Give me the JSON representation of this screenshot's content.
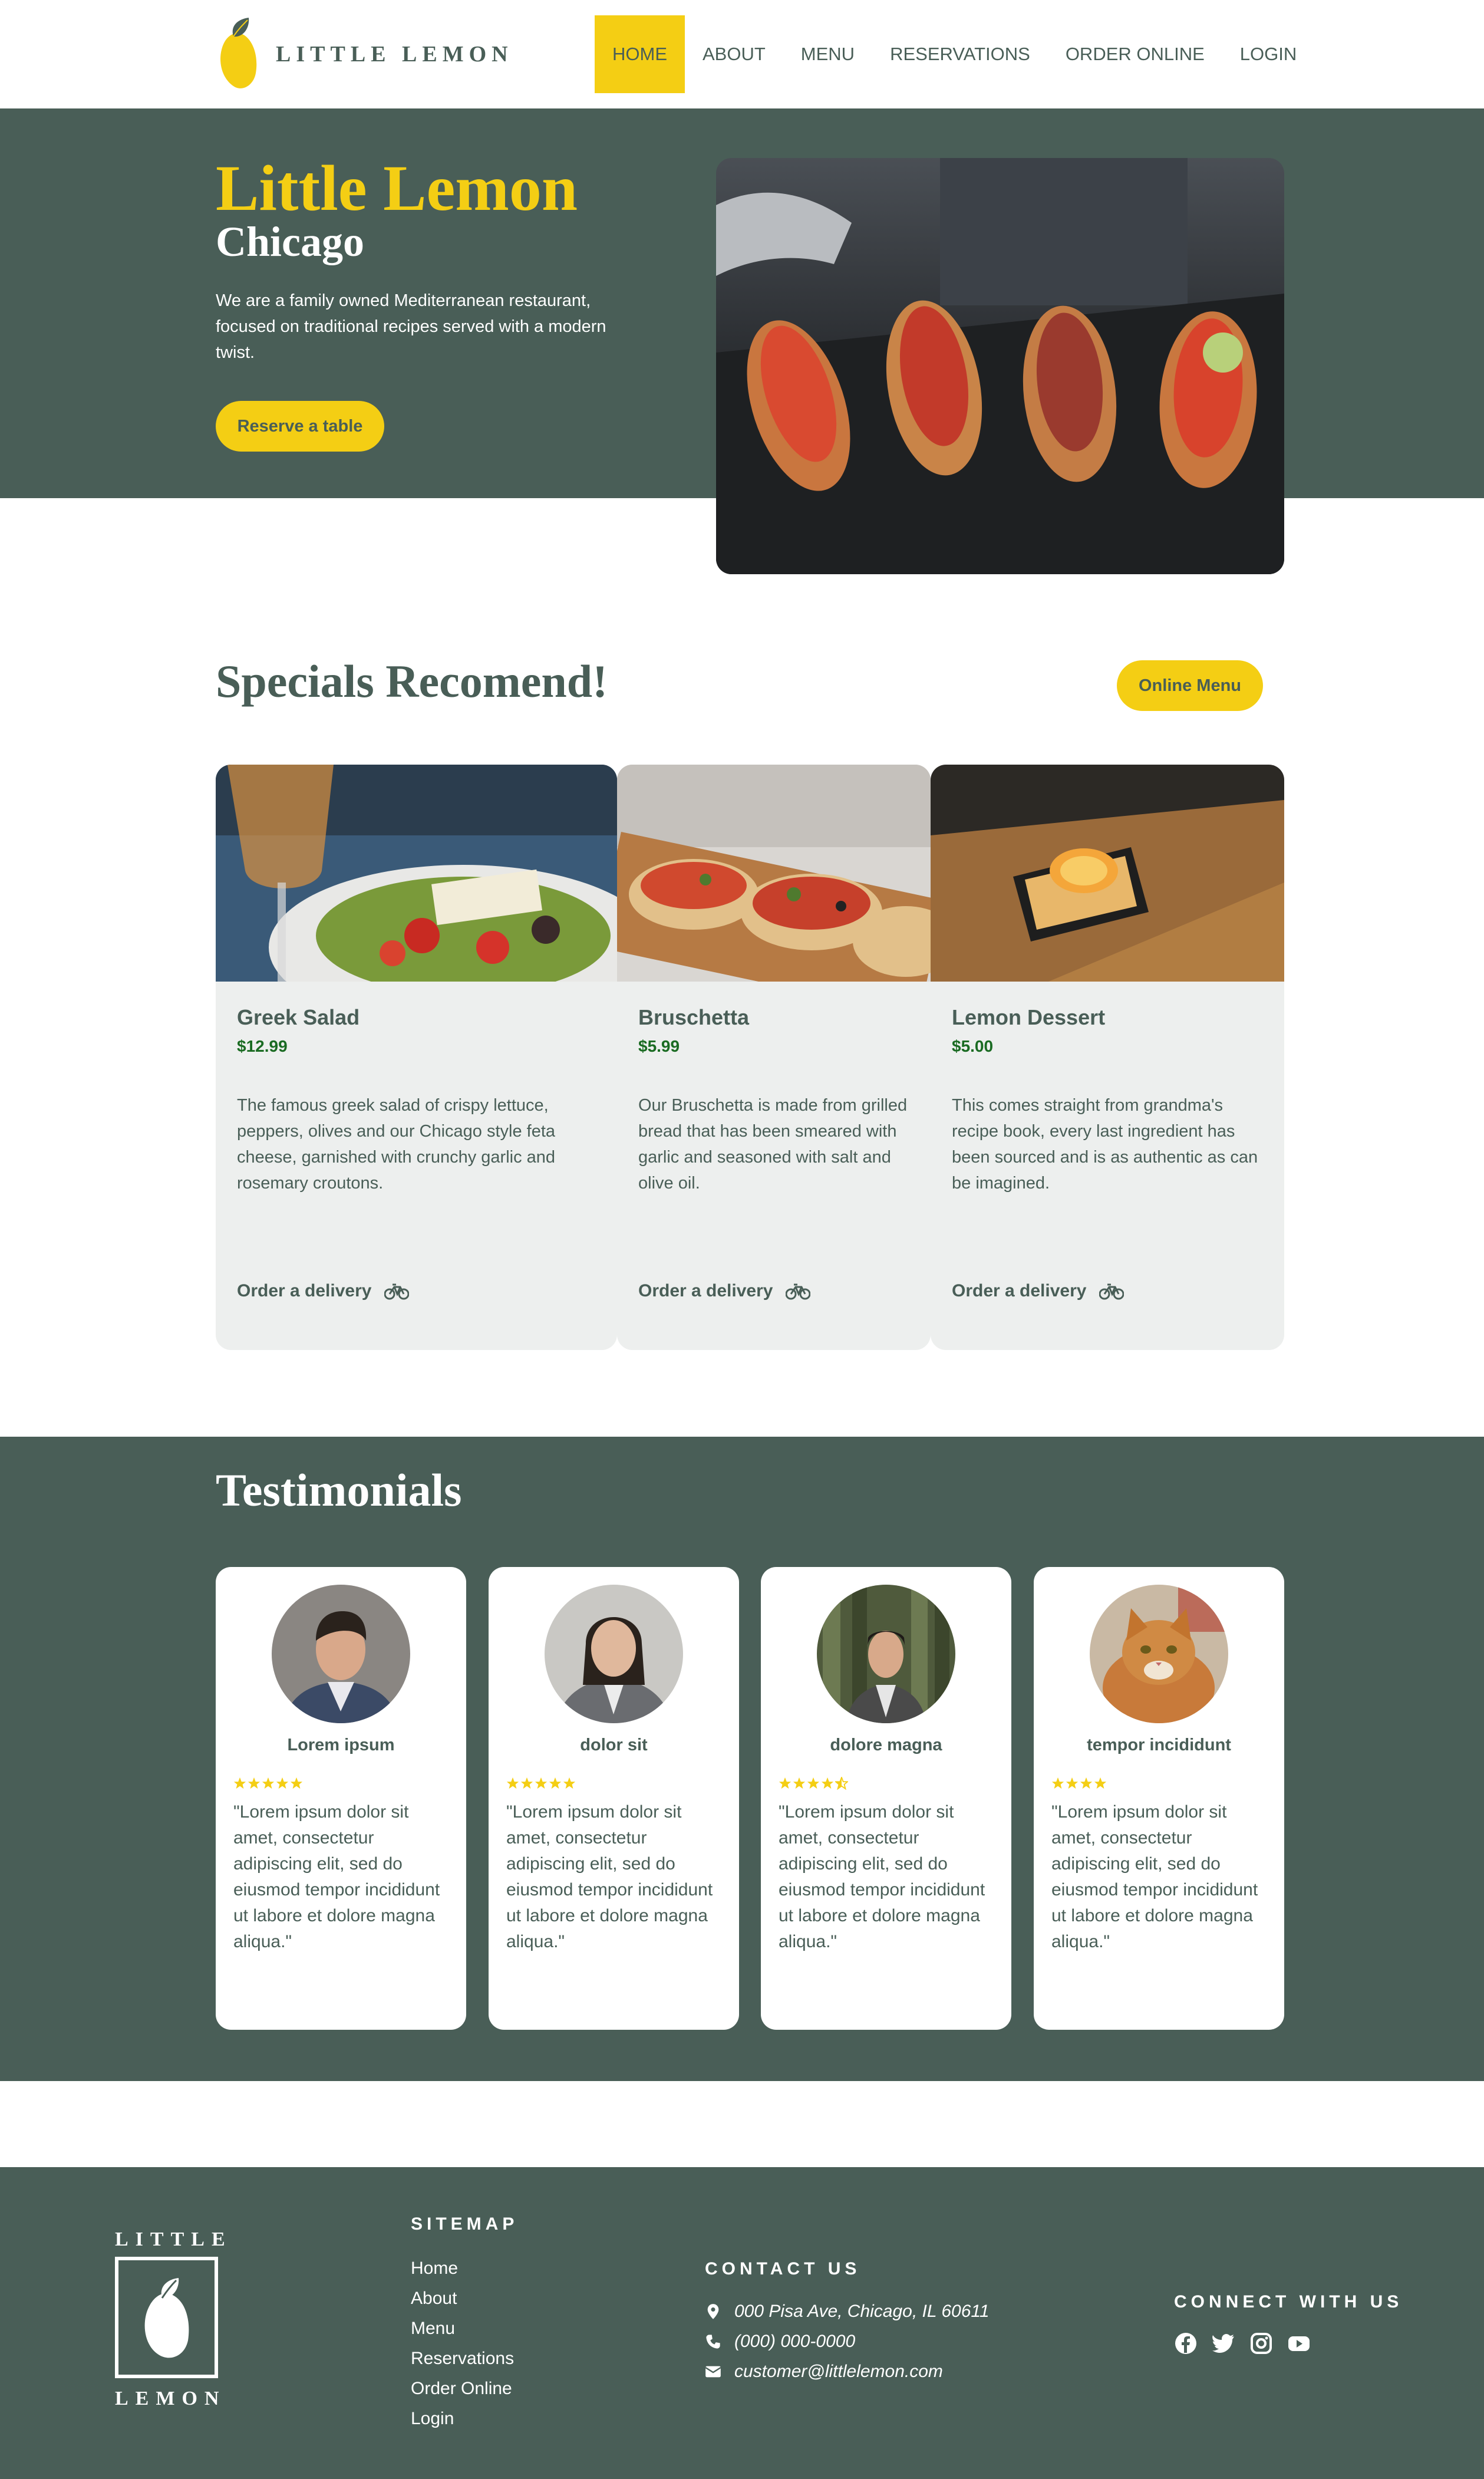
{
  "brand": {
    "name": "LITTLE LEMON",
    "footer_top": "LITTLE",
    "footer_bottom": "LEMON"
  },
  "colors": {
    "primary": "#495e57",
    "accent": "#f4ce14",
    "card_bg": "#edefee",
    "price": "#1a6b22"
  },
  "nav": {
    "items": [
      {
        "label": "HOME",
        "active": true
      },
      {
        "label": "ABOUT"
      },
      {
        "label": "MENU"
      },
      {
        "label": "RESERVATIONS"
      },
      {
        "label": "ORDER ONLINE"
      },
      {
        "label": "LOGIN"
      }
    ]
  },
  "hero": {
    "title": "Little Lemon",
    "subtitle": "Chicago",
    "description": "We are a family owned Mediterranean restaurant, focused on traditional recipes served with a modern twist.",
    "cta": "Reserve a table",
    "image": "bruschetta-on-slate-photo"
  },
  "specials": {
    "title": "Specials Recomend!",
    "menu_button": "Online Menu",
    "cards": [
      {
        "name": "Greek Salad",
        "price": "$12.99",
        "description": "The famous greek salad of crispy lettuce, peppers, olives and our Chicago style feta cheese, garnished with crunchy garlic and rosemary croutons.",
        "order": "Order a delivery",
        "icon": "bicycle-icon"
      },
      {
        "name": "Bruschetta",
        "price": "$5.99",
        "description": "Our Bruschetta is made from grilled bread that has been smeared with garlic and seasoned with salt and olive oil.",
        "order": "Order a delivery",
        "icon": "bicycle-icon"
      },
      {
        "name": "Lemon Dessert",
        "price": "$5.00",
        "description": "This comes straight from grandma's recipe book, every last ingredient has been sourced and is as authentic as can be imagined.",
        "order": "Order a delivery",
        "icon": "bicycle-icon"
      }
    ]
  },
  "testimonials": {
    "title": "Testimonials",
    "items": [
      {
        "name": "Lorem ipsum",
        "rating": 5,
        "quote": "\"Lorem ipsum dolor sit amet, consectetur adipiscing elit, sed do eiusmod tempor incididunt ut labore et dolore magna aliqua.\""
      },
      {
        "name": "dolor sit",
        "rating": 5,
        "quote": "\"Lorem ipsum dolor sit amet, consectetur adipiscing elit, sed do eiusmod tempor incididunt ut labore et dolore magna aliqua.\""
      },
      {
        "name": "dolore magna",
        "rating": 4.5,
        "quote": "\"Lorem ipsum dolor sit amet, consectetur adipiscing elit, sed do eiusmod tempor incididunt ut labore et dolore magna aliqua.\""
      },
      {
        "name": "tempor incididunt",
        "rating": 4,
        "quote": "\"Lorem ipsum dolor sit amet, consectetur adipiscing elit, sed do eiusmod tempor incididunt ut labore et dolore magna aliqua.\""
      }
    ]
  },
  "footer": {
    "sitemap_title": "SITEMAP",
    "sitemap": [
      "Home",
      "About",
      "Menu",
      "Reservations",
      "Order Online",
      "Login"
    ],
    "contact_title": "CONTACT US",
    "contact": [
      {
        "icon": "map-pin-icon",
        "text": "000 Pisa Ave, Chicago, IL 60611"
      },
      {
        "icon": "phone-icon",
        "text": "(000) 000-0000"
      },
      {
        "icon": "envelope-icon",
        "text": "customer@littlelemon.com"
      }
    ],
    "connect_title": "CONNECT WITH US",
    "social": [
      "facebook-icon",
      "twitter-icon",
      "instagram-icon",
      "youtube-icon"
    ]
  }
}
